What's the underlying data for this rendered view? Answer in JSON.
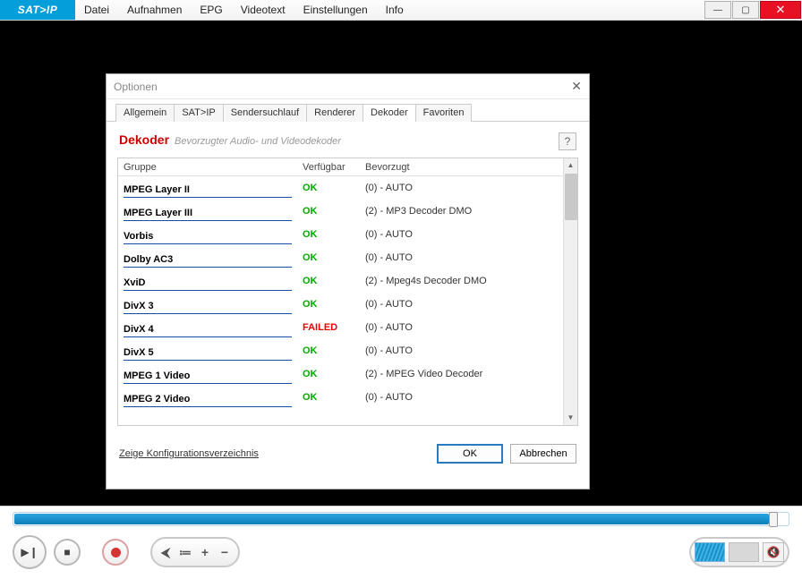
{
  "app": {
    "logo": "SAT>IP"
  },
  "menu": [
    "Datei",
    "Aufnahmen",
    "EPG",
    "Videotext",
    "Einstellungen",
    "Info"
  ],
  "dialog": {
    "title": "Optionen",
    "tabs": [
      "Allgemein",
      "SAT>IP",
      "Sendersuchlauf",
      "Renderer",
      "Dekoder",
      "Favoriten"
    ],
    "activeTab": "Dekoder",
    "heading": "Dekoder",
    "subheading": "Bevorzugter Audio- und Videodekoder",
    "help": "?",
    "columns": {
      "group": "Gruppe",
      "available": "Verfügbar",
      "preferred": "Bevorzugt"
    },
    "rows": [
      {
        "group": "MPEG Layer II",
        "avail": "OK",
        "pref": "(0) - AUTO"
      },
      {
        "group": "MPEG Layer III",
        "avail": "OK",
        "pref": "(2) - MP3 Decoder DMO"
      },
      {
        "group": "Vorbis",
        "avail": "OK",
        "pref": "(0) - AUTO"
      },
      {
        "group": "Dolby AC3",
        "avail": "OK",
        "pref": "(0) - AUTO"
      },
      {
        "group": "XviD",
        "avail": "OK",
        "pref": "(2) - Mpeg4s Decoder DMO"
      },
      {
        "group": "DivX 3",
        "avail": "OK",
        "pref": "(0) - AUTO"
      },
      {
        "group": "DivX 4",
        "avail": "FAILED",
        "pref": "(0) - AUTO"
      },
      {
        "group": "DivX 5",
        "avail": "OK",
        "pref": "(0) - AUTO"
      },
      {
        "group": "MPEG 1 Video",
        "avail": "OK",
        "pref": "(2) - MPEG Video Decoder"
      },
      {
        "group": "MPEG 2 Video",
        "avail": "OK",
        "pref": "(0) - AUTO"
      }
    ],
    "configLink": "Zeige Konfigurationsverzeichnis",
    "okBtn": "OK",
    "cancelBtn": "Abbrechen"
  },
  "player": {
    "play": "▶❙",
    "stop": "■",
    "prev": "⮜",
    "list": "≔",
    "plus": "+",
    "minus": "−",
    "mute": "🔇"
  }
}
